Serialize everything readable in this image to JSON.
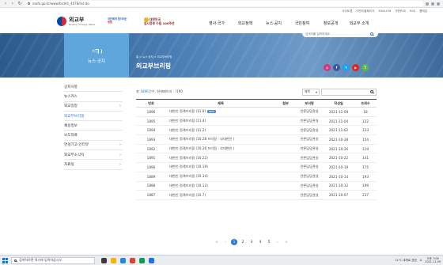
{
  "browser": {
    "url": "mofa.go.kr/www/brd/m_4078/list.do"
  },
  "util_links": [
    "사이트맵",
    "어린이홈페이지",
    "ENGLISH",
    "국문RSS",
    "RSS",
    "웹메일"
  ],
  "header": {
    "logo_main": "외교부",
    "logo_sub": "Ministry of Foreign Affairs",
    "campaign1_line1": "국민에게 힘이되는",
    "campaign1_line2": "청렴",
    "campaign2_line1": "대한민국",
    "campaign2_line2": "임시정부 수립 100주년",
    "nav": [
      "영사·국가",
      "외교정책",
      "뉴스·공지",
      "국민참여",
      "정보공개",
      "외교부 소개"
    ]
  },
  "banner": {
    "section_title": "뉴스·공지",
    "search_placeholder": "검색어를 입력하세요",
    "breadcrumb": "홈 > 뉴스·공지 > 외교부브리핑",
    "page_title": "외교부브리핑",
    "socials": [
      {
        "name": "instagram-icon",
        "glyph": "◎",
        "color": "#d6337b"
      },
      {
        "name": "facebook-icon",
        "glyph": "f",
        "color": "#3b5998"
      },
      {
        "name": "twitter-icon",
        "glyph": "t",
        "color": "#1da1f2"
      },
      {
        "name": "youtube-icon",
        "glyph": "▶",
        "color": "#e62117"
      },
      {
        "name": "talk-icon",
        "glyph": "T",
        "color": "#58b947"
      }
    ]
  },
  "left_nav": [
    {
      "label": "공지사항",
      "chevron": false
    },
    {
      "label": "뉴스커스",
      "chevron": false
    },
    {
      "label": "외교일정",
      "chevron": true
    },
    {
      "label": "외교부브리핑",
      "chevron": false,
      "active": true
    },
    {
      "label": "채용정보",
      "chevron": false
    },
    {
      "label": "보도자료",
      "chevron": false
    },
    {
      "label": "연설기고·인터뷰",
      "chevron": true
    },
    {
      "label": "외교부소식지",
      "chevron": true
    },
    {
      "label": "자료실",
      "chevron": true
    }
  ],
  "list": {
    "count_prefix": "총 ",
    "count_num": "1896",
    "count_suffix": "건수, 현재페이지 : /190",
    "filter_label": "제목",
    "columns": [
      "번호",
      "제목",
      "첨부",
      "부서명",
      "작성일",
      "조회수"
    ],
    "rows": [
      {
        "no": "1896",
        "title": "대변인 정례브리핑 (11.9)",
        "new": "NEW",
        "dept": "언론담당관실",
        "date": "2021-11-09",
        "views": "18"
      },
      {
        "no": "1895",
        "title": "대변인 정례브리핑 (11.4)",
        "new": "",
        "dept": "언론담당관실",
        "date": "2021-11-04",
        "views": "122"
      },
      {
        "no": "1894",
        "title": "대변인 정례브리핑 (11.2)",
        "new": "",
        "dept": "언론담당관실",
        "date": "2021-11-02",
        "views": "133"
      },
      {
        "no": "1893",
        "title": "대변인 정례브리핑 (10.28 브리핑 : 부대변인 )",
        "new": "",
        "dept": "언론담당관실",
        "date": "2021-10-28",
        "views": "154"
      },
      {
        "no": "1892",
        "title": "대변인 정례브리핑 (10.26 브리핑 : 부대변인 )",
        "new": "",
        "dept": "언론담당관실",
        "date": "2021-10-26",
        "views": "119"
      },
      {
        "no": "1891",
        "title": "대변인 정례브리핑 (10.22)",
        "new": "",
        "dept": "언론담당관실",
        "date": "2021-10-22",
        "views": "141"
      },
      {
        "no": "1890",
        "title": "대변인 정례브리핑 (10.19)",
        "new": "",
        "dept": "언론담당관실",
        "date": "2021-10-19",
        "views": "175"
      },
      {
        "no": "1889",
        "title": "대변인 정례브리핑 (10.14)",
        "new": "",
        "dept": "언론담당관실",
        "date": "2021-10-14",
        "views": "193"
      },
      {
        "no": "1888",
        "title": "대변인 정례브리핑 (10.12)",
        "new": "",
        "dept": "언론담당관실",
        "date": "2021-10-12",
        "views": "199"
      },
      {
        "no": "1887",
        "title": "대변인 정례브리핑 (10.7)",
        "new": "",
        "dept": "언론담당관실",
        "date": "2021-10-07",
        "views": "237"
      }
    ]
  },
  "pagination": {
    "first": "«",
    "prev": "‹",
    "pages": [
      "1",
      "2",
      "3",
      "4",
      "5"
    ],
    "next": "›",
    "last": "»"
  },
  "taskbar": {
    "search_text": "검색하려면 여기에 입력하십시오.",
    "weather": "11°C 대체로 흐림",
    "ime": "A",
    "time": "오후 7:06",
    "date": "2021-11-09"
  }
}
